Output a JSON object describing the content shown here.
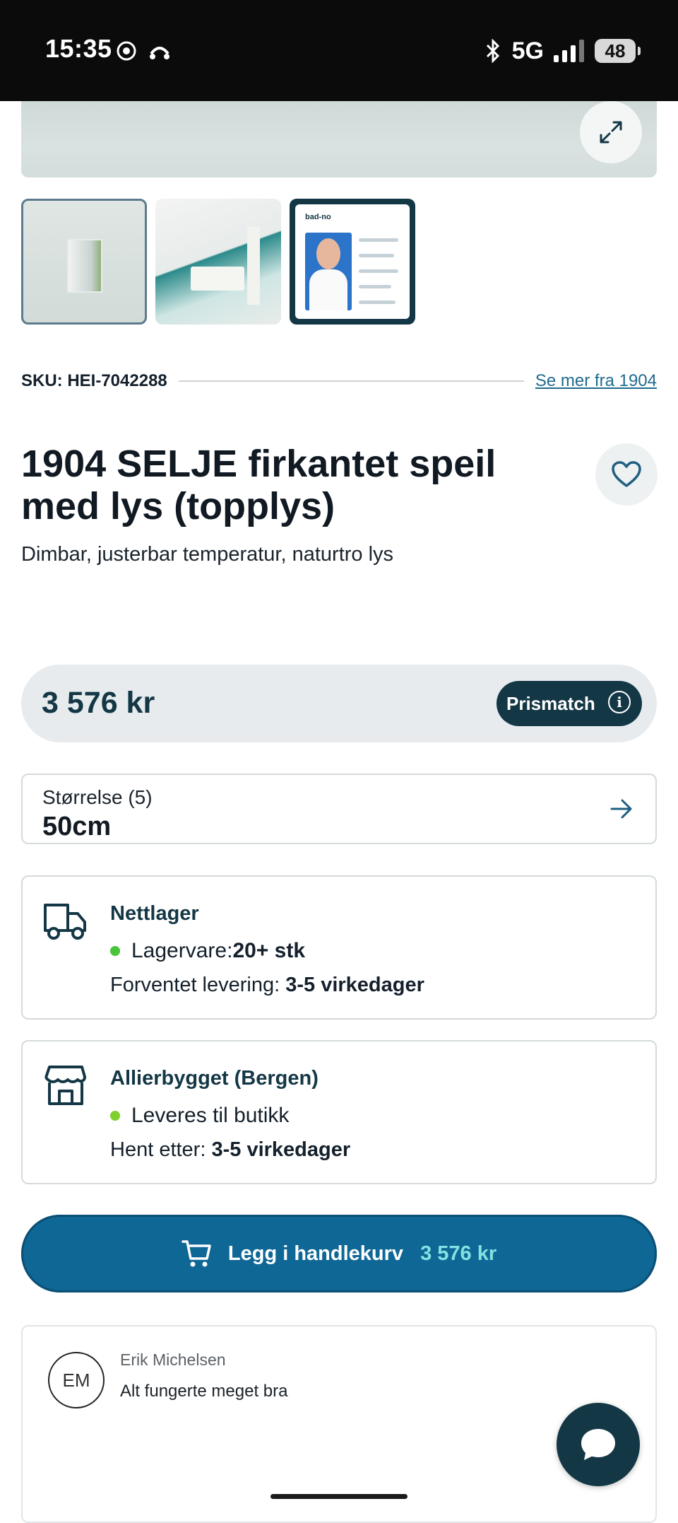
{
  "status_bar": {
    "time": "15:35",
    "network": "5G",
    "battery": "48"
  },
  "gallery": {
    "expand_icon": "expand-icon",
    "thumbnails": [
      {
        "name": "mirror-product-thumbnail",
        "active": true
      },
      {
        "name": "bathroom-scene-thumbnail",
        "active": false
      },
      {
        "name": "badno-info-thumbnail",
        "active": false,
        "brand": "bad-no"
      }
    ]
  },
  "sku": {
    "text": "SKU: HEI-7042288",
    "more_link": "Se mer fra 1904"
  },
  "product": {
    "title": "1904 SELJE firkantet speil med lys (topplys)",
    "subtitle": "Dimbar, justerbar temperatur, naturtro lys"
  },
  "price": {
    "amount": "3 576 kr",
    "prismatch_label": "Prismatch",
    "info_glyph": "i"
  },
  "size": {
    "label": "Størrelse (5)",
    "value": "50cm"
  },
  "stock": {
    "online": {
      "title": "Nettlager",
      "status_prefix": "Lagervare: ",
      "status_value": "20+ stk",
      "eta_prefix": "Forventet levering: ",
      "eta_value": "3-5 virkedager",
      "dot_color": "#49c23c"
    },
    "store": {
      "title": "Allierbygget (Bergen)",
      "status_text": "Leveres til butikk",
      "eta_prefix": "Hent etter: ",
      "eta_value": "3-5 virkedager",
      "dot_color": "#7fd12e"
    }
  },
  "cart": {
    "label": "Legg i handlekurv",
    "price": "3 576 kr"
  },
  "review": {
    "initials": "EM",
    "name": "Erik Michelsen",
    "text": "Alt fungerte meget bra"
  },
  "colors": {
    "primary_dark": "#143746",
    "cart_blue": "#0f6796",
    "link": "#1f6b8e",
    "price_accent": "#7fe3e0"
  }
}
